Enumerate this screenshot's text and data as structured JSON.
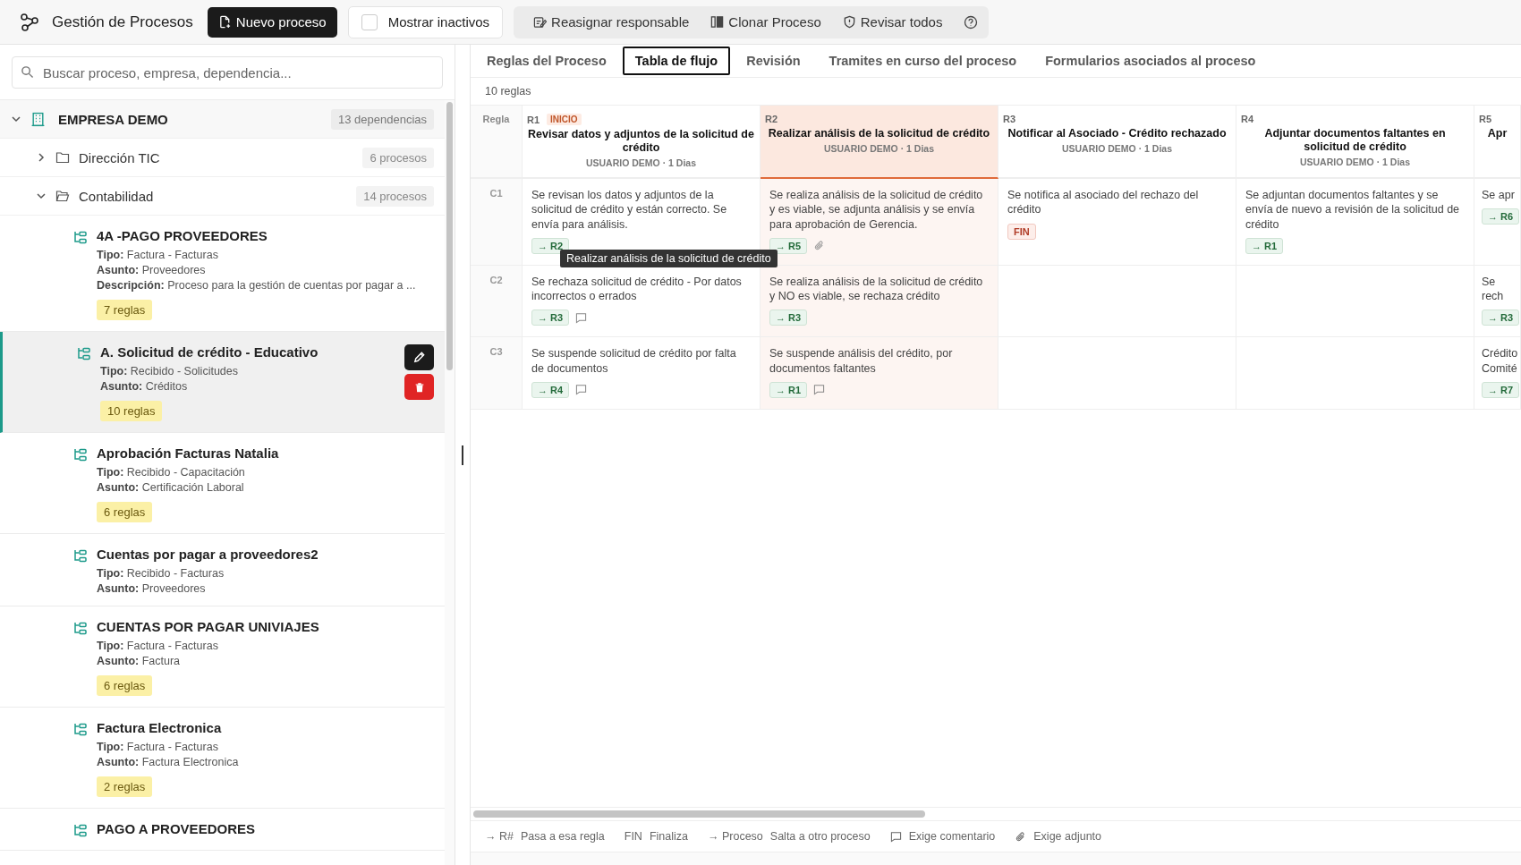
{
  "toolbar": {
    "title": "Gestión de Procesos",
    "new_button": "Nuevo proceso",
    "show_inactive": {
      "label": "Mostrar inactivos",
      "checked": false
    },
    "actions": [
      {
        "kind": "reassign",
        "label": "Reasignar responsable"
      },
      {
        "kind": "clone",
        "label": "Clonar Proceso"
      },
      {
        "kind": "review",
        "label": "Revisar todos"
      }
    ]
  },
  "sidebar": {
    "search": {
      "placeholder": "Buscar proceso, empresa, dependencia..."
    },
    "tree": [
      {
        "label": "EMPRESA DEMO",
        "count": "13 dependencias",
        "expanded": true,
        "children": [
          {
            "label": "Dirección TIC",
            "count": "6 procesos",
            "expanded": false
          },
          {
            "label": "Contabilidad",
            "count": "14 procesos",
            "expanded": true,
            "children": [
              {
                "name": "4A -PAGO PROVEEDORES",
                "selected": false,
                "fields": [
                  {
                    "label": "Tipo:",
                    "value": "Factura - Facturas"
                  },
                  {
                    "label": "Asunto:",
                    "value": "Proveedores"
                  },
                  {
                    "label": "Descripción:",
                    "value": "Proceso para la gestión de cuentas por pagar a ..."
                  }
                ],
                "badge": "7 reglas"
              },
              {
                "name": "A. Solicitud de crédito - Educativo",
                "selected": true,
                "fields": [
                  {
                    "label": "Tipo:",
                    "value": "Recibido - Solicitudes"
                  },
                  {
                    "label": "Asunto:",
                    "value": "Créditos"
                  }
                ],
                "badge": "10 reglas"
              },
              {
                "name": "Aprobación Facturas Natalia",
                "selected": false,
                "fields": [
                  {
                    "label": "Tipo:",
                    "value": "Recibido - Capacitación"
                  },
                  {
                    "label": "Asunto:",
                    "value": "Certificación Laboral"
                  }
                ],
                "badge": "6 reglas"
              },
              {
                "name": "Cuentas por pagar a proveedores2",
                "selected": false,
                "fields": [
                  {
                    "label": "Tipo:",
                    "value": "Recibido - Facturas"
                  },
                  {
                    "label": "Asunto:",
                    "value": "Proveedores"
                  }
                ]
              },
              {
                "name": "CUENTAS POR PAGAR UNIVIAJES",
                "selected": false,
                "fields": [
                  {
                    "label": "Tipo:",
                    "value": "Factura - Facturas"
                  },
                  {
                    "label": "Asunto:",
                    "value": "Factura"
                  }
                ],
                "badge": "6 reglas"
              },
              {
                "name": "Factura Electronica",
                "selected": false,
                "fields": [
                  {
                    "label": "Tipo:",
                    "value": "Factura - Facturas"
                  },
                  {
                    "label": "Asunto:",
                    "value": "Factura Electronica"
                  }
                ],
                "badge": "2 reglas"
              },
              {
                "name": "PAGO A PROVEEDORES",
                "selected": false
              }
            ]
          }
        ]
      }
    ]
  },
  "tabs": [
    {
      "label": "Reglas del Proceso",
      "selected": false
    },
    {
      "label": "Tabla de flujo",
      "selected": true
    },
    {
      "label": "Revisión",
      "selected": false
    },
    {
      "label": "Tramites en curso del proceso",
      "selected": false
    },
    {
      "label": "Formularios asociados al proceso",
      "selected": false
    }
  ],
  "rule_count": "10 reglas",
  "table": {
    "corner": "Regla",
    "columns": [
      {
        "id": "R1",
        "tag": "INICIO",
        "title": "Revisar datos y adjuntos de la solicitud de crédito",
        "meta": "USUARIO DEMO · 1 Dias",
        "highlighted": false
      },
      {
        "id": "R2",
        "title": "Realizar análisis de la solicitud de crédito",
        "meta": "USUARIO DEMO · 1 Dias",
        "highlighted": true
      },
      {
        "id": "R3",
        "title": "Notificar al Asociado - Crédito rechazado",
        "meta": "USUARIO DEMO · 1 Dias",
        "highlighted": false
      },
      {
        "id": "R4",
        "title": "Adjuntar documentos faltantes en solicitud de crédito",
        "meta": "USUARIO DEMO · 1 Dias",
        "highlighted": false
      },
      {
        "id": "R5",
        "title": "Apr",
        "highlighted": false
      }
    ],
    "rows": [
      {
        "id": "C1",
        "cells": [
          {
            "text": "Se revisan los datos y adjuntos de la solicitud de crédito y están correcto. Se envía para análisis.",
            "target": {
              "kind": "goto",
              "label": "→ R2"
            },
            "comment": false,
            "attachment": false
          },
          {
            "text": "Se realiza análisis de la solicitud de crédito y es viable, se adjunta análisis y se envía para aprobación de Gerencia.",
            "target": {
              "kind": "goto",
              "label": "→ R5"
            },
            "comment": false,
            "attachment": true
          },
          {
            "text": "Se notifica al asociado del rechazo del crédito",
            "target": {
              "kind": "end",
              "label": "FIN"
            },
            "comment": false,
            "attachment": false
          },
          {
            "text": "Se adjuntan documentos faltantes y se envía de nuevo a revisión de la solicitud de crédito",
            "target": {
              "kind": "goto",
              "label": "→ R1"
            },
            "comment": false,
            "attachment": false
          },
          {
            "text": "Se apr",
            "target": {
              "kind": "goto",
              "label": "→ R6"
            }
          }
        ]
      },
      {
        "id": "C2",
        "cells": [
          {
            "text": "Se rechaza solicitud de crédito - Por datos incorrectos o errados",
            "target": {
              "kind": "goto",
              "label": "→ R3"
            },
            "comment": true,
            "attachment": false
          },
          {
            "text": "Se realiza análisis de la solicitud de crédito y NO es viable, se rechaza crédito",
            "target": {
              "kind": "goto",
              "label": "→ R3"
            },
            "comment": false,
            "attachment": false
          },
          null,
          null,
          {
            "text": "Se rech",
            "target": {
              "kind": "goto",
              "label": "→ R3"
            }
          }
        ]
      },
      {
        "id": "C3",
        "cells": [
          {
            "text": "Se suspende solicitud de crédito por falta de documentos",
            "target": {
              "kind": "goto",
              "label": "→ R4"
            },
            "comment": true,
            "attachment": false
          },
          {
            "text": "Se suspende análisis del crédito, por documentos faltantes",
            "target": {
              "kind": "goto",
              "label": "→ R1"
            },
            "comment": true,
            "attachment": false
          },
          null,
          null,
          {
            "text": "Crédito Comité",
            "target": {
              "kind": "goto",
              "label": "→ R7"
            }
          }
        ]
      }
    ],
    "tooltip": "Realizar análisis de la solicitud de crédito"
  },
  "legend": [
    {
      "kind": "symbol",
      "symbol": "→ R#",
      "text": "Pasa a esa regla"
    },
    {
      "kind": "symbol",
      "symbol": "FIN",
      "text": "Finaliza"
    },
    {
      "kind": "symbol",
      "symbol": "→ Proceso",
      "text": "Salta a otro proceso"
    },
    {
      "kind": "comment",
      "text": "Exige comentario"
    },
    {
      "kind": "attachment",
      "text": "Exige adjunto"
    }
  ]
}
